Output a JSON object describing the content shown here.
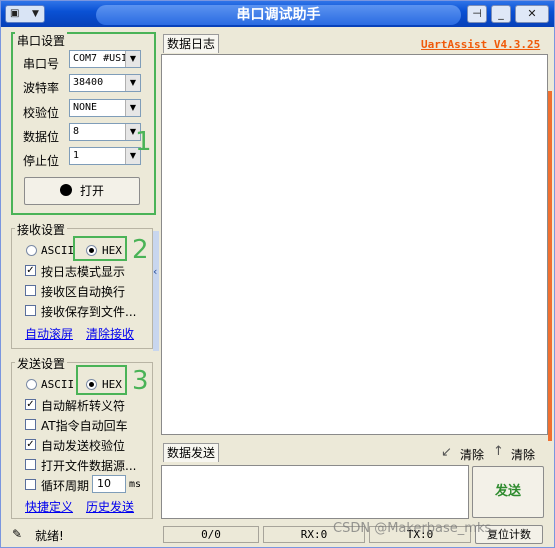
{
  "window": {
    "title": "串口调试助手",
    "version_label": "UartAssist V4.3.25"
  },
  "serial_settings": {
    "legend": "串口设置",
    "port_label": "串口号",
    "port_value": "COM7 #USI",
    "baud_label": "波特率",
    "baud_value": "38400",
    "parity_label": "校验位",
    "parity_value": "NONE",
    "databits_label": "数据位",
    "databits_value": "8",
    "stopbits_label": "停止位",
    "stopbits_value": "1",
    "open_button": "打开"
  },
  "receive_settings": {
    "legend": "接收设置",
    "ascii_label": "ASCII",
    "hex_label": "HEX",
    "selected": "HEX",
    "log_mode_label": "按日志模式显示",
    "log_mode_checked": true,
    "auto_wrap_label": "接收区自动换行",
    "auto_wrap_checked": false,
    "save_to_file_label": "接收保存到文件...",
    "save_to_file_checked": false,
    "auto_scroll_link": "自动滚屏",
    "clear_receive_link": "清除接收"
  },
  "send_settings": {
    "legend": "发送设置",
    "ascii_label": "ASCII",
    "hex_label": "HEX",
    "selected": "HEX",
    "auto_escape_label": "自动解析转义符",
    "auto_escape_checked": true,
    "at_auto_cr_label": "AT指令自动回车",
    "at_auto_cr_checked": false,
    "auto_checksum_label": "自动发送校验位",
    "auto_checksum_checked": true,
    "open_file_label": "打开文件数据源...",
    "open_file_checked": false,
    "cycle_label": "循环周期",
    "cycle_checked": false,
    "cycle_value": "10",
    "cycle_unit": "ms",
    "shortcut_link": "快捷定义",
    "history_link": "历史发送"
  },
  "annotations": {
    "one": "1",
    "two": "2",
    "three": "3"
  },
  "log_panel": {
    "tab": "数据日志"
  },
  "send_panel": {
    "tab": "数据发送",
    "clear1": "清除",
    "clear2": "清除",
    "send_button": "发送"
  },
  "status_bar": {
    "ready": "就绪!",
    "counter": "0/0",
    "rx": "RX:0",
    "tx": "TX:0",
    "reset_button": "复位计数"
  },
  "watermark": "CSDN @Makerbase_mks",
  "colors": {
    "accent_green": "#4ab357",
    "version_orange": "#f05a0a",
    "title_blue": "#0a51d4",
    "send_green": "#2e8b2e"
  }
}
